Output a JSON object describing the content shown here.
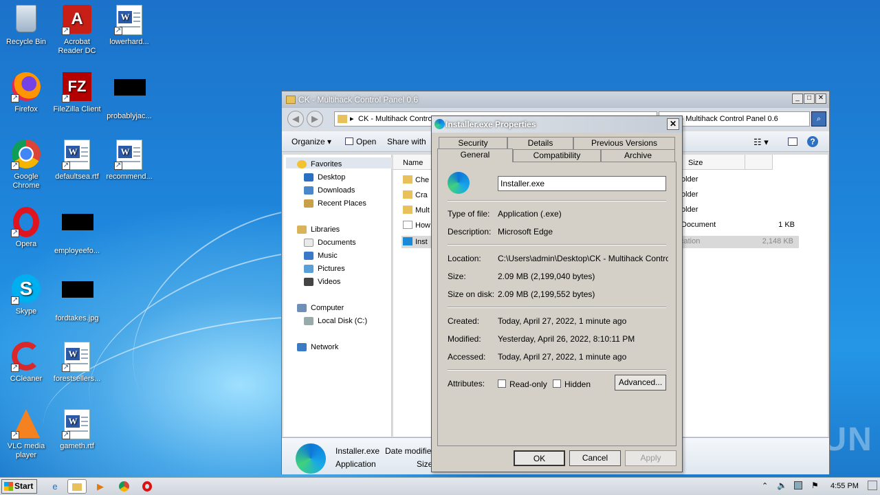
{
  "desktop": {
    "icons": [
      {
        "label": "Recycle Bin",
        "icon": "recycle-bin-icon"
      },
      {
        "label": "Acrobat Reader DC",
        "icon": "acrobat-icon"
      },
      {
        "label": "lowerhard...",
        "icon": "word-doc-icon"
      },
      {
        "label": "Firefox",
        "icon": "firefox-icon"
      },
      {
        "label": "FileZilla Client",
        "icon": "filezilla-icon"
      },
      {
        "label": "probablyjac...",
        "icon": "redacted-file-icon"
      },
      {
        "label": "Google Chrome",
        "icon": "chrome-icon"
      },
      {
        "label": "defaultsea.rtf",
        "icon": "word-doc-icon"
      },
      {
        "label": "recommend...",
        "icon": "word-doc-icon"
      },
      {
        "label": "Opera",
        "icon": "opera-icon"
      },
      {
        "label": "employeefo...",
        "icon": "redacted-file-icon"
      },
      {
        "label": "Skype",
        "icon": "skype-icon"
      },
      {
        "label": "fordtakes.jpg",
        "icon": "redacted-file-icon"
      },
      {
        "label": "CCleaner",
        "icon": "ccleaner-icon"
      },
      {
        "label": "forestsellers...",
        "icon": "word-doc-icon"
      },
      {
        "label": "VLC media player",
        "icon": "vlc-icon"
      },
      {
        "label": "gameth.rtf",
        "icon": "word-doc-icon"
      }
    ],
    "watermark": "ANY RUN"
  },
  "explorer": {
    "title": "CK - Multihack Control Panel 0.6",
    "address": "CK - Multihack Control",
    "search_value": "h CK - Multihack Control Panel 0.6",
    "commands": {
      "organize": "Organize",
      "open": "Open",
      "share": "Share with"
    },
    "nav": {
      "favorites": "Favorites",
      "desktop": "Desktop",
      "downloads": "Downloads",
      "recent": "Recent Places",
      "libraries": "Libraries",
      "documents": "Documents",
      "music": "Music",
      "pictures": "Pictures",
      "videos": "Videos",
      "computer": "Computer",
      "local_disk": "Local Disk (C:)",
      "network": "Network"
    },
    "columns": {
      "name": "Name",
      "size": "Size"
    },
    "rows": [
      {
        "name": "Che",
        "type": "older",
        "size": ""
      },
      {
        "name": "Cra",
        "type": "older",
        "size": ""
      },
      {
        "name": "Mult",
        "type": "older",
        "size": ""
      },
      {
        "name": "How",
        "type": "Document",
        "size": "1 KB"
      },
      {
        "name": "Inst",
        "type": "cation",
        "size": "2,148 KB"
      }
    ],
    "details": {
      "name": "Installer.exe",
      "type": "Application",
      "date_label": "Date modified",
      "size_label": "Size"
    }
  },
  "dialog": {
    "title": "Installer.exe Properties",
    "tabs_top": [
      "Security",
      "Details",
      "Previous Versions"
    ],
    "tabs_bottom": [
      "General",
      "Compatibility",
      "Archive"
    ],
    "filename": "Installer.exe",
    "type_label": "Type of file:",
    "type_value": "Application (.exe)",
    "desc_label": "Description:",
    "desc_value": "Microsoft Edge",
    "loc_label": "Location:",
    "loc_value": "C:\\Users\\admin\\Desktop\\CK - Multihack Control Pa",
    "size_label": "Size:",
    "size_value": "2.09 MB (2,199,040 bytes)",
    "disk_label": "Size on disk:",
    "disk_value": "2.09 MB (2,199,552 bytes)",
    "created_label": "Created:",
    "created_value": "Today, April 27, 2022, 1 minute ago",
    "modified_label": "Modified:",
    "modified_value": "Yesterday, April 26, 2022, 8:10:11 PM",
    "accessed_label": "Accessed:",
    "accessed_value": "Today, April 27, 2022, 1 minute ago",
    "attr_label": "Attributes:",
    "readonly": "Read-only",
    "hidden": "Hidden",
    "advanced": "Advanced...",
    "ok": "OK",
    "cancel": "Cancel",
    "apply": "Apply"
  },
  "taskbar": {
    "start": "Start",
    "clock": "4:55 PM"
  }
}
